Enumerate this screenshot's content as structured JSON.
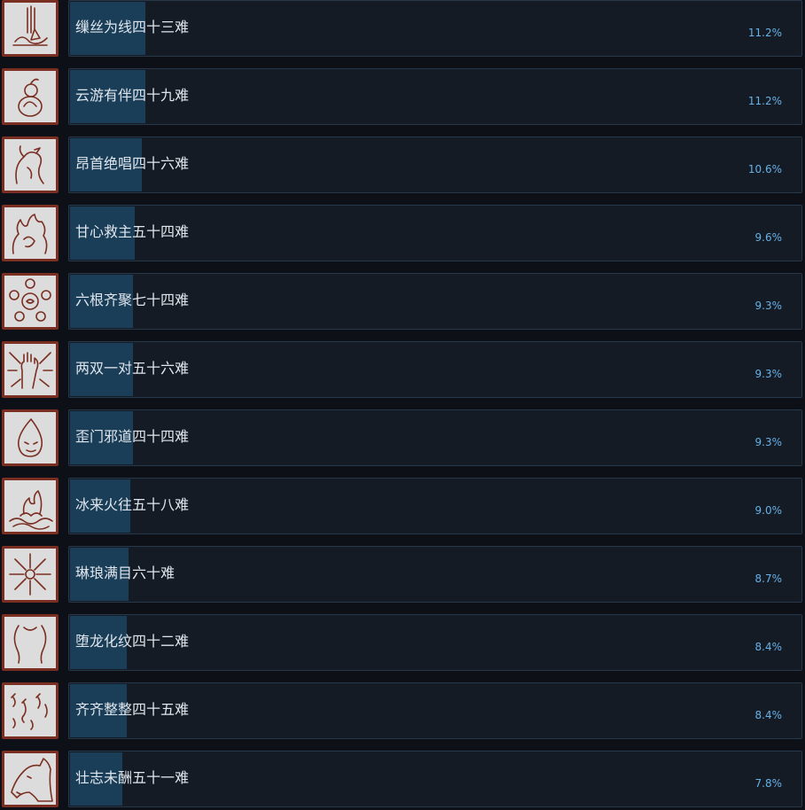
{
  "achievements": [
    {
      "name": "缫丝为线四十三难",
      "percent_label": "11.2%",
      "percent": 11.2,
      "icon": "loom-icon"
    },
    {
      "name": "云游有伴四十九难",
      "percent_label": "11.2%",
      "percent": 11.2,
      "icon": "gourd-icon"
    },
    {
      "name": "昂首绝唱四十六难",
      "percent_label": "10.6%",
      "percent": 10.6,
      "icon": "rooster-icon"
    },
    {
      "name": "甘心救主五十四难",
      "percent_label": "9.6%",
      "percent": 9.6,
      "icon": "flame-figure-icon"
    },
    {
      "name": "六根齐聚七十四难",
      "percent_label": "9.3%",
      "percent": 9.3,
      "icon": "six-roots-icon"
    },
    {
      "name": "两双一对五十六难",
      "percent_label": "9.3%",
      "percent": 9.3,
      "icon": "radiant-hand-icon"
    },
    {
      "name": "歪门邪道四十四难",
      "percent_label": "9.3%",
      "percent": 9.3,
      "icon": "face-drop-icon"
    },
    {
      "name": "冰来火往五十八难",
      "percent_label": "9.0%",
      "percent": 9.0,
      "icon": "fire-water-icon"
    },
    {
      "name": "琳琅满目六十难",
      "percent_label": "8.7%",
      "percent": 8.7,
      "icon": "starburst-icon"
    },
    {
      "name": "堕龙化纹四十二难",
      "percent_label": "8.4%",
      "percent": 8.4,
      "icon": "horns-icon"
    },
    {
      "name": "齐齐整整四十五难",
      "percent_label": "8.4%",
      "percent": 8.4,
      "icon": "scorpions-icon"
    },
    {
      "name": "壮志未酬五十一难",
      "percent_label": "7.8%",
      "percent": 7.8,
      "icon": "horse-head-icon"
    }
  ],
  "colors": {
    "background": "#0d1117",
    "panel": "#141b24",
    "bar": "#1a3d58",
    "percent_text": "#66b1e8",
    "icon_frame": "#7a2f22"
  }
}
